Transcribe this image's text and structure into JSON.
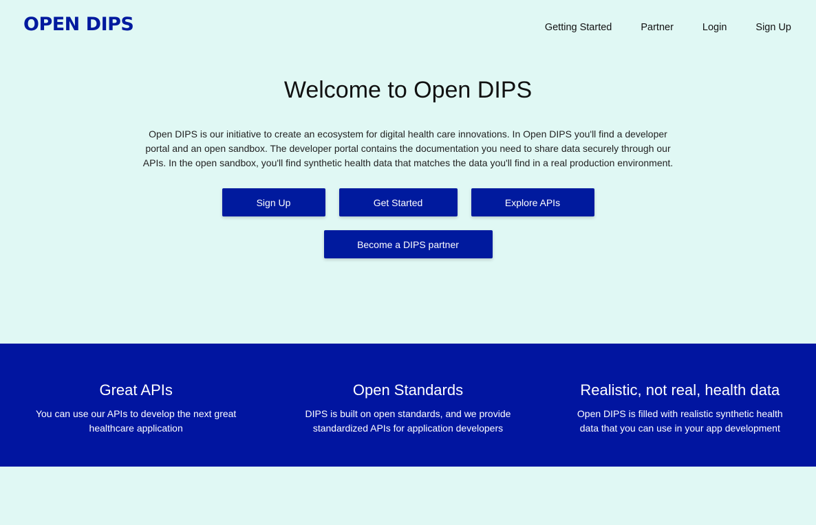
{
  "header": {
    "logo": "OPEN DIPS",
    "nav": [
      "Getting Started",
      "Partner",
      "Login",
      "Sign Up"
    ]
  },
  "hero": {
    "title": "Welcome to Open DIPS",
    "description": "Open DIPS is our initiative to create an ecosystem for digital health care innovations. In Open DIPS you'll find a developer portal and an open sandbox. The developer portal contains the documentation you need to share data securely through our APIs. In the open sandbox, you'll find synthetic health data that matches the data you'll find in a real production environment.",
    "buttons": {
      "sign_up": "Sign Up",
      "get_started": "Get Started",
      "explore_apis": "Explore APIs",
      "become_partner": "Become a DIPS partner"
    }
  },
  "features": [
    {
      "title": "Great APIs",
      "text": "You can use our APIs to develop the next great healthcare application"
    },
    {
      "title": "Open Standards",
      "text": "DIPS is built on open standards, and we provide standardized APIs for application developers"
    },
    {
      "title": "Realistic, not real, health data",
      "text": "Open DIPS is filled with realistic synthetic health data that you can use in your app development"
    }
  ],
  "colors": {
    "background": "#e0f8f4",
    "brand": "#001a9e",
    "band": "#0115a0"
  }
}
